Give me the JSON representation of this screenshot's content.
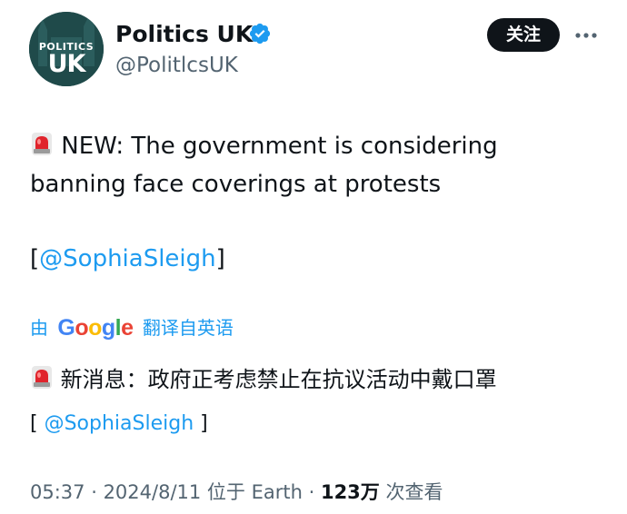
{
  "account": {
    "display_name": "Politics UK",
    "handle": "@PolitlcsUK",
    "avatar_text_small": "POLITICS",
    "avatar_text_big": "UK",
    "verified": true
  },
  "actions": {
    "follow_label": "关注",
    "more_icon": "more-horizontal-icon"
  },
  "tweet": {
    "emoji": "siren-emoji",
    "line1": "NEW: The government is considering",
    "line2": "banning face coverings at protests",
    "mention_open": "[",
    "mention": "@SophiaSleigh",
    "mention_close": "]"
  },
  "translation": {
    "prefix": "由",
    "provider": "Google",
    "suffix": "翻译自英语",
    "text": "新消息：政府正考虑禁止在抗议活动中戴口罩",
    "mention_open": "[ ",
    "mention": "@SophiaSleigh",
    "mention_close": " ]"
  },
  "meta": {
    "time": "05:37",
    "sep1": " · ",
    "date": "2024/8/11",
    "location": " 位于 Earth",
    "sep2": " · ",
    "views_count": "123万",
    "views_label": " 次查看"
  },
  "colors": {
    "link": "#1d9bf0",
    "muted": "#536471",
    "text": "#0f1419",
    "avatar_bg": "#1f4a4a",
    "verified": "#1d9bf0"
  }
}
